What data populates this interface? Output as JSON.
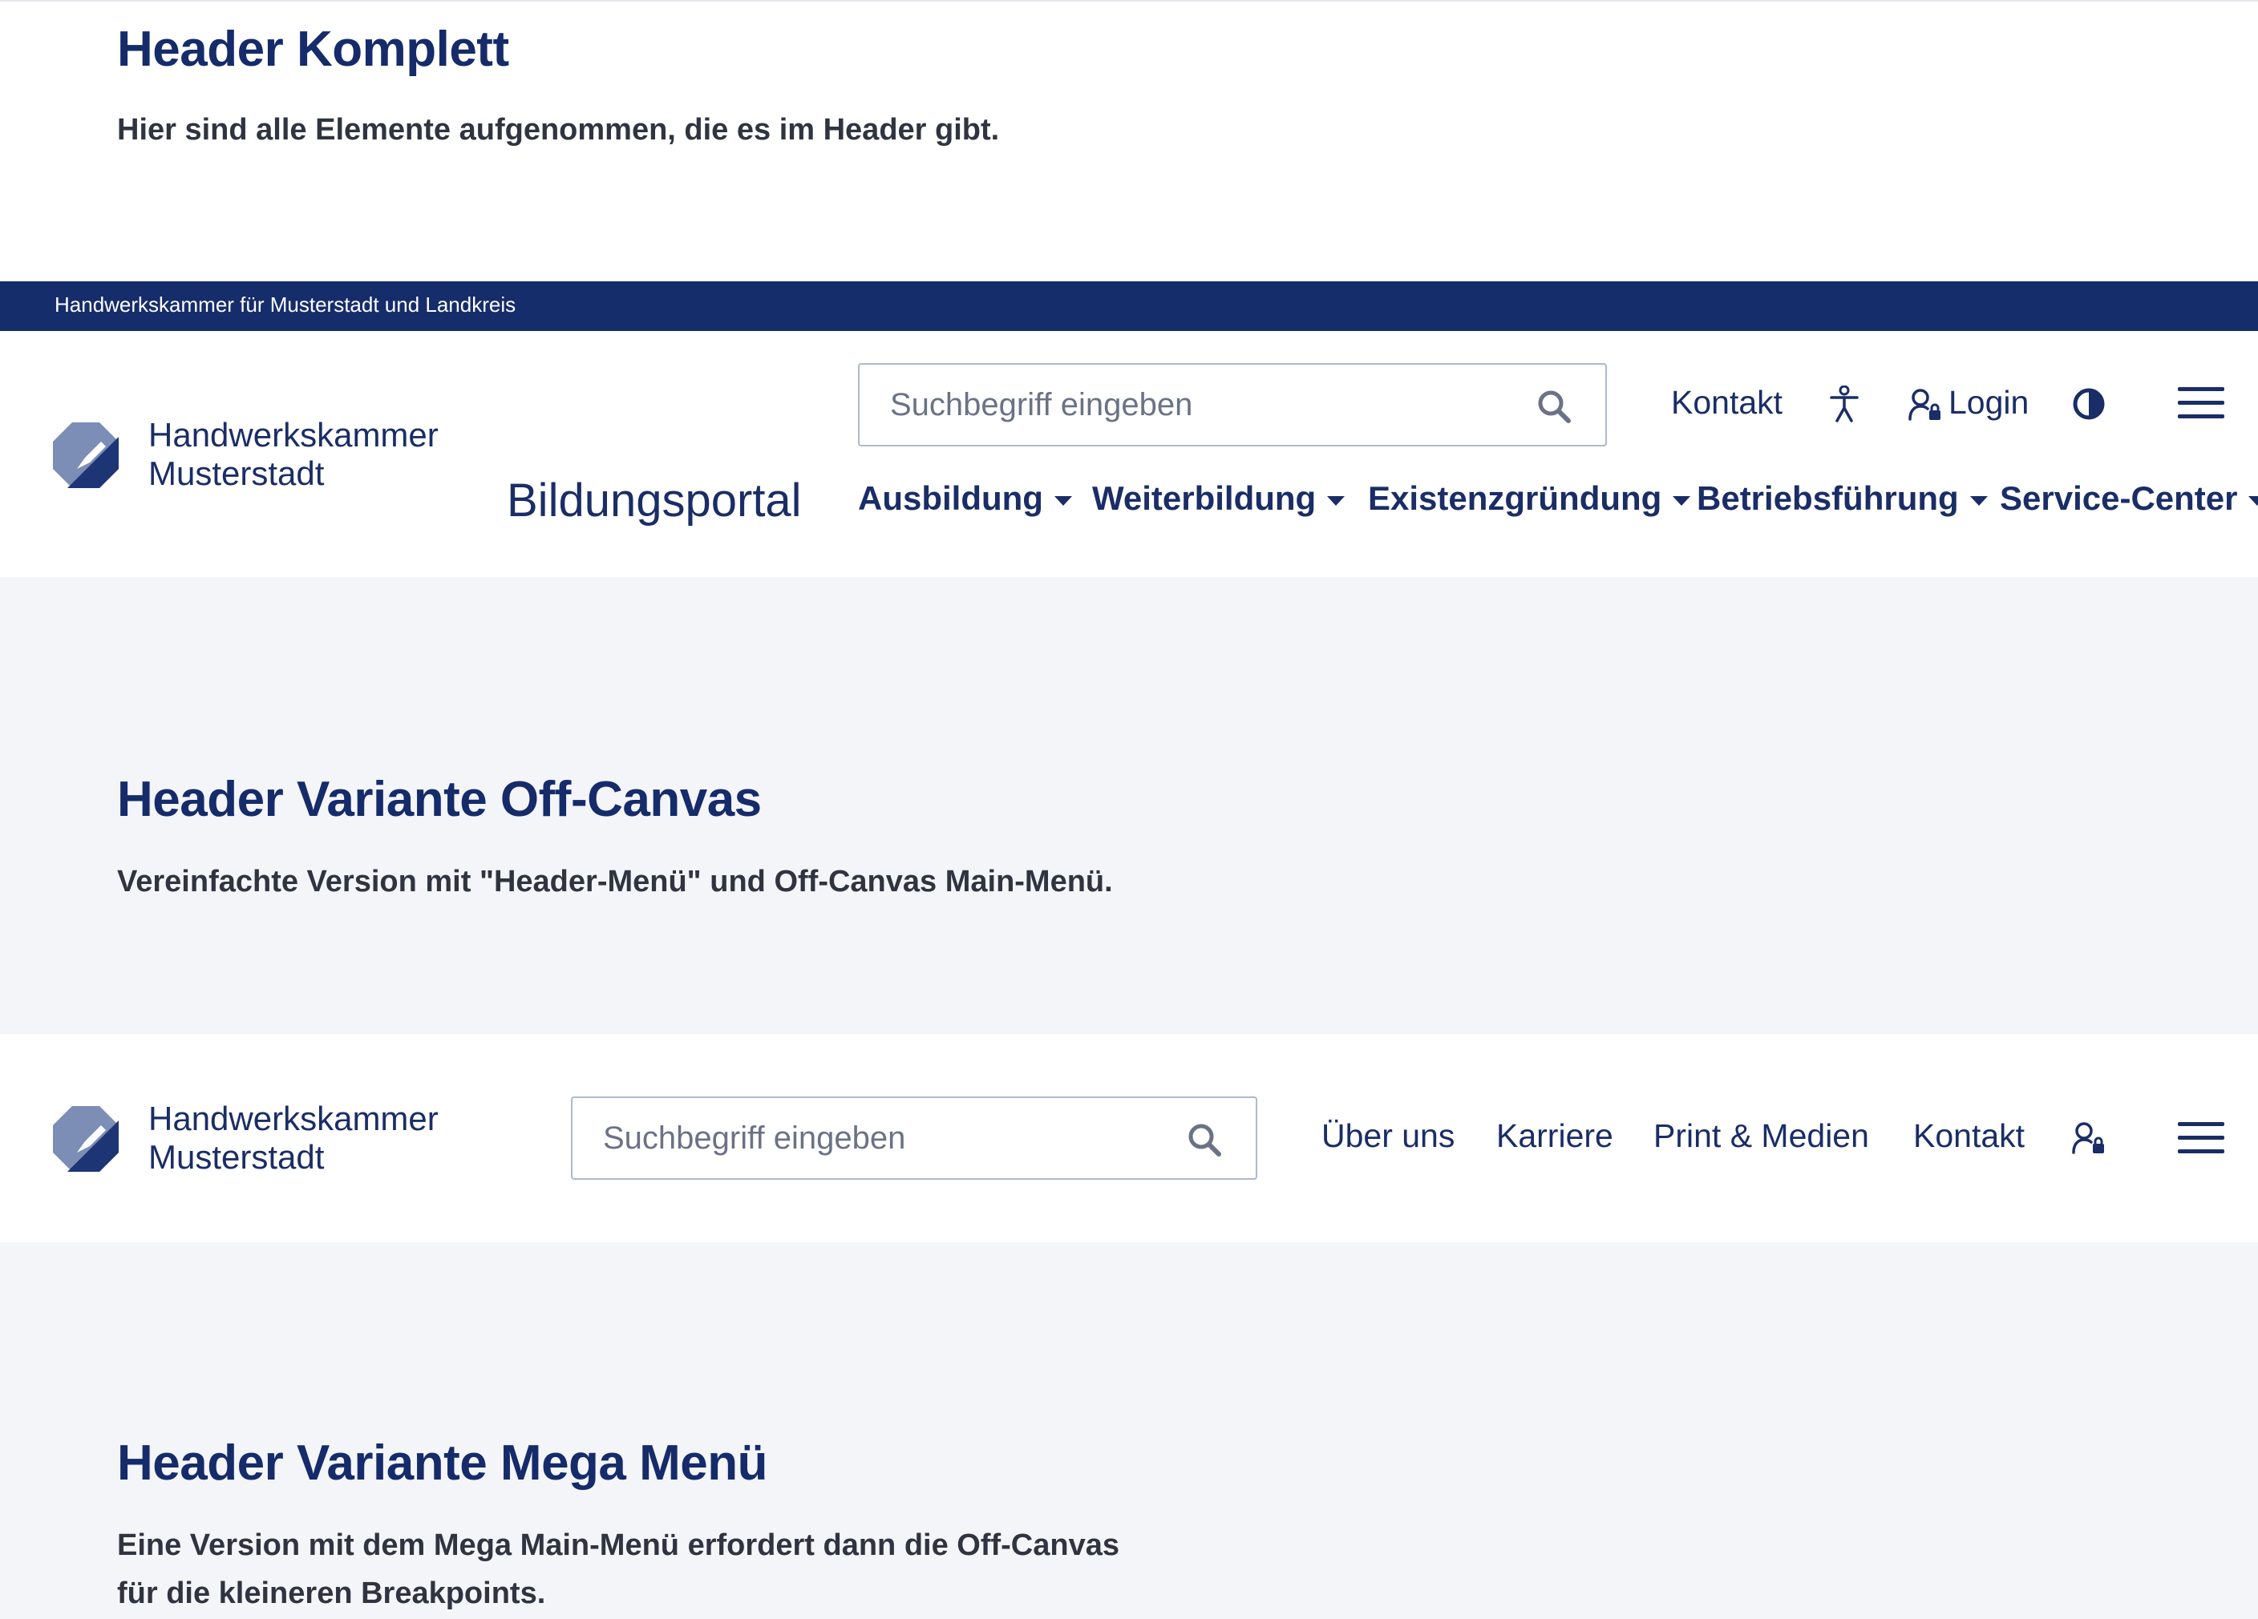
{
  "section_complete": {
    "title": "Header Komplett",
    "description": "Hier sind alle Elemente aufgenommen, die es im Header gibt."
  },
  "topbar": {
    "text": "Handwerkskammer für Musterstadt und Landkreis",
    "background": "#162d6b"
  },
  "header_complete": {
    "logo_line1": "Handwerkskammer",
    "logo_line2": "Musterstadt",
    "portal_name": "Bildungsportal",
    "search_placeholder": "Suchbegriff eingeben",
    "contact_link": "Kontakt",
    "login_link": "Login",
    "icons": [
      "accessibility-icon",
      "user-lock-icon",
      "contrast-icon",
      "menu-icon",
      "search-icon"
    ],
    "nav": [
      {
        "label": "Ausbildung"
      },
      {
        "label": "Weiterbildung"
      },
      {
        "label": "Existenzgründung"
      },
      {
        "label": "Betriebsführung"
      },
      {
        "label": "Service-Center"
      }
    ]
  },
  "section_offcanvas": {
    "title": "Header Variante Off-Canvas",
    "description": "Vereinfachte Version mit \"Header-Menü\" und Off-Canvas Main-Menü."
  },
  "header_offcanvas": {
    "logo_line1": "Handwerkskammer",
    "logo_line2": "Musterstadt",
    "search_placeholder": "Suchbegriff eingeben",
    "links": [
      {
        "label": "Über uns"
      },
      {
        "label": "Karriere"
      },
      {
        "label": "Print & Medien"
      },
      {
        "label": "Kontakt"
      }
    ],
    "icons": [
      "user-lock-icon",
      "menu-icon",
      "search-icon"
    ]
  },
  "section_mega": {
    "title": "Header Variante Mega Menü",
    "description_line1": "Eine Version mit dem Mega Main-Menü erfordert dann die Off-Canvas",
    "description_line2": "für die kleineren Breakpoints."
  },
  "colors": {
    "brand_navy": "#1a2d66",
    "grey_background": "#f4f5f9",
    "logo_light": "#7c8db6"
  }
}
